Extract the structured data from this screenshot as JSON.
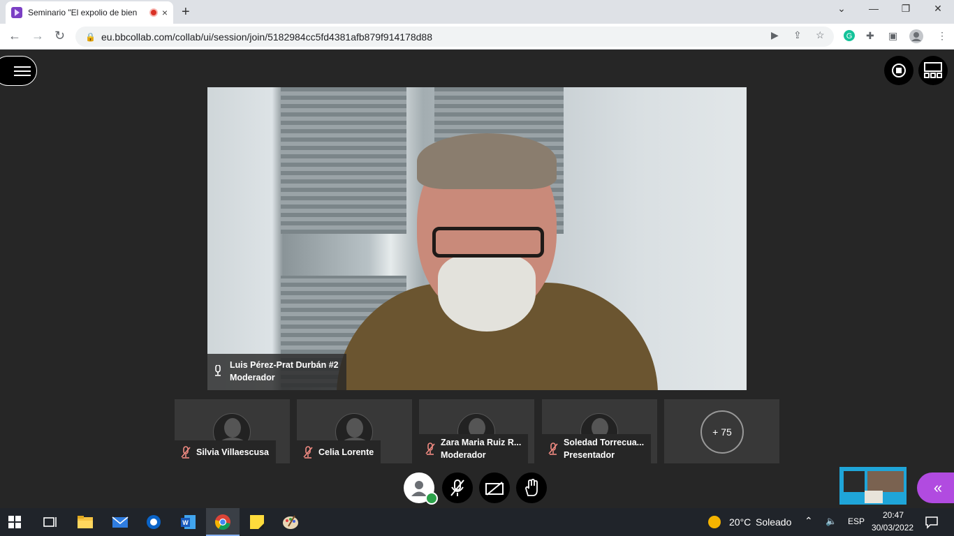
{
  "browser": {
    "tab_title": "Seminario \"El expolio de bien",
    "url": "eu.bbcollab.com/collab/ui/session/join/5182984cc5fd4381afb879f914178d88",
    "new_tab": "+",
    "tab_close": "×"
  },
  "session": {
    "speaker": {
      "name": "Luis Pérez-Prat Durbán #2",
      "role": "Moderador"
    },
    "participants": [
      {
        "name": "Silvia Villaescusa",
        "role": ""
      },
      {
        "name": "Celia Lorente",
        "role": ""
      },
      {
        "name": "Zara Maria Ruiz R...",
        "role": "Moderador"
      },
      {
        "name": "Soledad Torrecua...",
        "role": "Presentador"
      }
    ],
    "more_count": "+ 75",
    "panel_toggle": "«",
    "colors": {
      "accent": "#b14be0",
      "ok": "#2ca24a",
      "mute": "#f28b82"
    }
  },
  "taskbar": {
    "weather_temp": "20°C",
    "weather_desc": "Soleado",
    "lang": "ESP",
    "time": "20:47",
    "date": "30/03/2022"
  }
}
